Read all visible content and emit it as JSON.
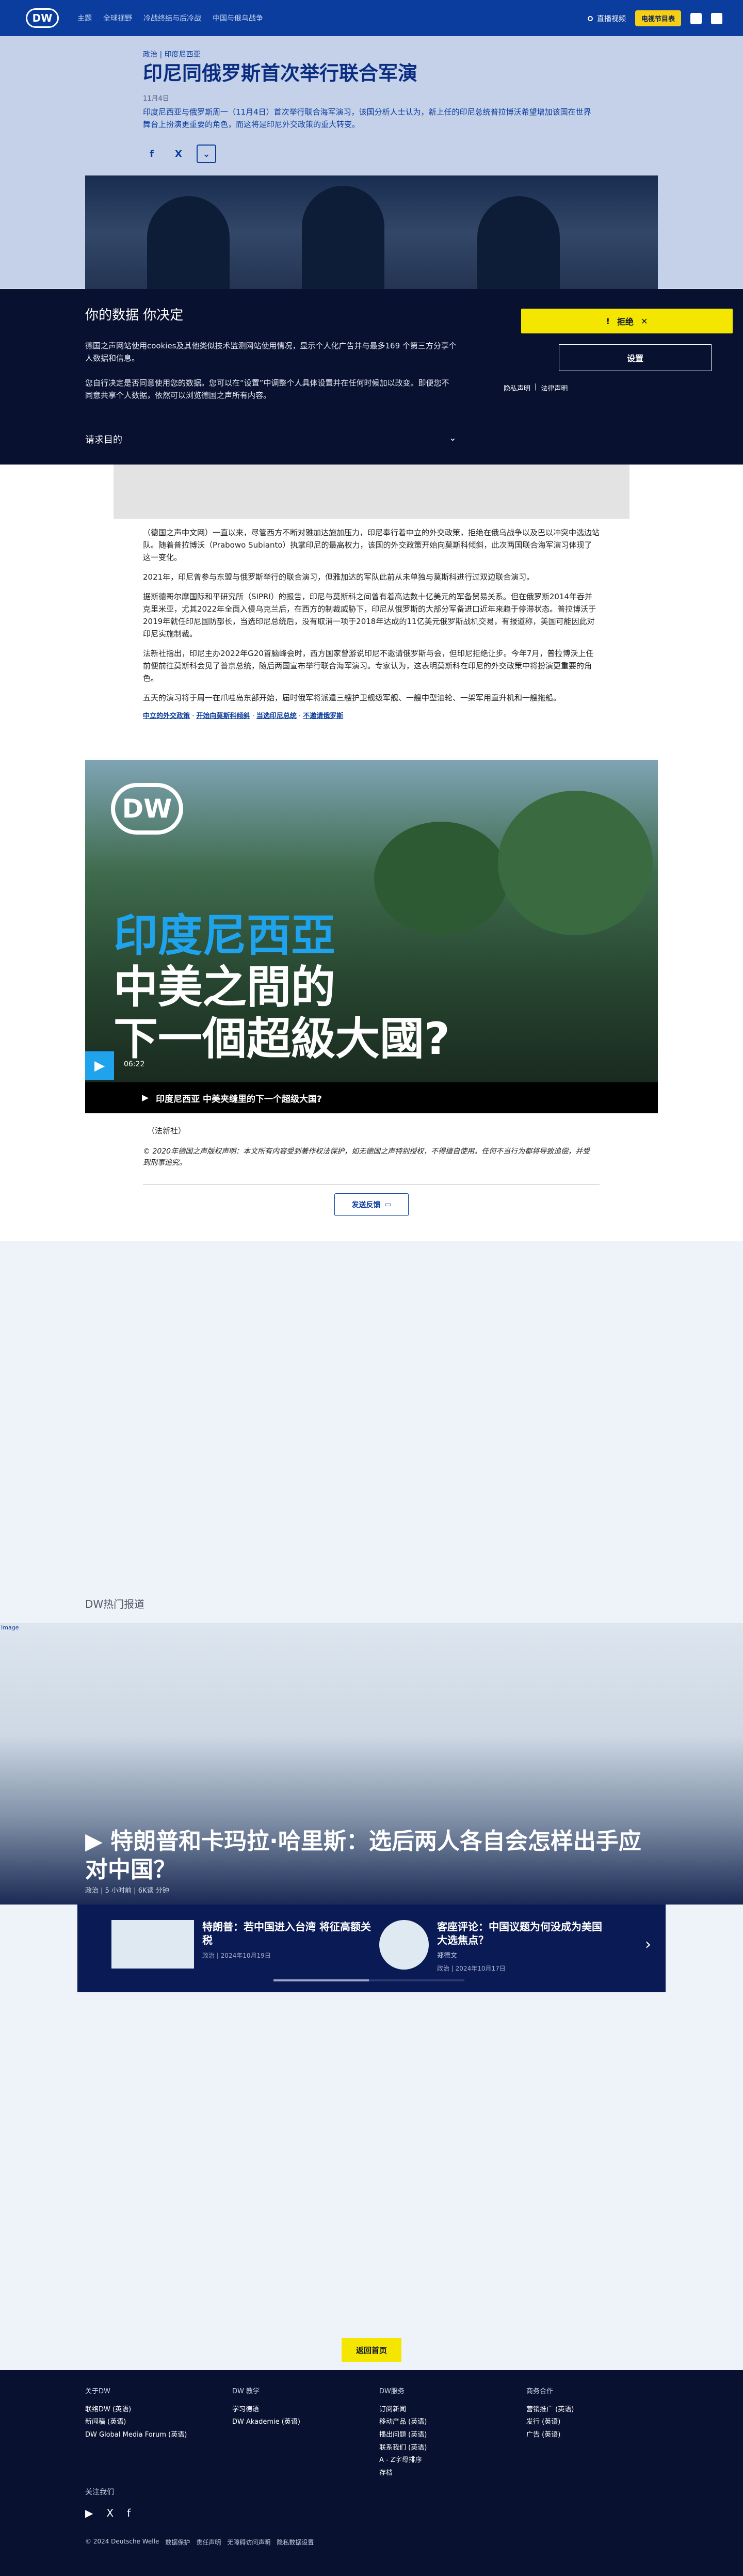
{
  "header": {
    "logo": "DW",
    "nav": [
      "主题",
      "全球视野",
      "冷战终结与后冷战",
      "中国与俄乌战争"
    ],
    "live_label": "直播视频",
    "schedule_label": "电视节目表"
  },
  "article": {
    "kicker": "政治 | 印度尼西亚",
    "title": "印尼同俄罗斯首次举行联合军演",
    "date": "11月4日",
    "lead": "印度尼西亚与俄罗斯周一（11月4日）首次举行联合海军演习，该国分析人士认为，新上任的印尼总统普拉博沃希望增加该国在世界舞台上扮演更重要的角色，而这将是印尼外交政策的重大转变。",
    "share": {
      "facebook": "f",
      "x": "X"
    },
    "paragraphs": [
      {
        "text": "（德国之声中文网）一直以来，尽管西方不断对雅加达施加压力，印尼奉行着中立的外交政策，拒绝在俄乌战争以及巴以冲突中选边站队。随着普拉博沃（Prabowo Subianto）执掌印尼的最高权力，该国的外交政策开始向莫斯科倾斜，此次两国联合海军演习体现了这一变化。"
      },
      {
        "text": "2021年，印尼曾参与东盟与俄罗斯举行的联合演习，但雅加达的军队此前从未单独与莫斯科进行过双边联合演习。"
      },
      {
        "text": "据斯德哥尔摩国际和平研究所（SIPRI）的报告，印尼与莫斯科之间曾有着高达数十亿美元的军备贸易关系。但在俄罗斯2014年吞并克里米亚，尤其2022年全面入侵乌克兰后，在西方的制裁威胁下，印尼从俄罗斯的大部分军备进口近年来趋于停滞状态。普拉博沃于2019年就任印尼国防部长，当选印尼总统后，没有取消一项于2018年达成的11亿美元俄罗斯战机交易，有报道称，美国可能因此对印尼实施制裁。"
      },
      {
        "text": "法新社指出，印尼主办2022年G20首脑峰会时，西方国家曾游说印尼不邀请俄罗斯与会，但印尼拒绝让步。今年7月，普拉博沃上任前便前往莫斯科会见了普京总统，随后两国宣布举行联合海军演习。专家认为，这表明莫斯科在印尼的外交政策中将扮演更重要的角色。"
      },
      {
        "text": "五天的演习将于周一在爪哇岛东部开始，届时俄军将派遣三艘护卫舰级军舰、一艘中型油轮、一架军用直升机和一艘拖船。"
      }
    ],
    "links": [
      "中立的外交政策",
      "开始向莫斯科倾斜",
      "当选印尼总统",
      "不邀请俄罗斯"
    ],
    "video": {
      "logo": "DW",
      "line1": "印度尼西亞",
      "line2": "中美之間的",
      "line3": "下一個超級大國?",
      "duration": "06:22",
      "caption": "印度尼西亚 中美夹缝里的下一个超级大国?"
    },
    "source": "（法新社）",
    "copyright": "© 2020年德国之声版权声明：本文所有内容受到著作权法保护，如无德国之声特别授权，不得擅自使用。任何不当行为都将导致追偿，并受到刑事追究。",
    "feedback_label": "发送反馈"
  },
  "cookie": {
    "title": "你的数据 你决定",
    "p1": "德国之声网站使用cookies及其他类似技术监测网站使用情况，显示个人化广告并与最多169 个第三方分享个人数据和信息。",
    "p2": "您自行决定是否同意使用您的数据。您可以在“设置”中调整个人具体设置并在任何时候加以改变。即便您不同意共享个人数据，依然可以浏览德国之声所有内容。",
    "reject_label": "拒绝",
    "settings_label": "设置",
    "privacy_label": "隐私声明",
    "legal_label": "法律声明",
    "purpose_label": "请求目的"
  },
  "trending": {
    "section_title": "DW热门报道",
    "broken_img_alt": "Image",
    "feature_title": "特朗普和卡玛拉·哈里斯：选后两人各自会怎样出手应对中国？",
    "feature_meta": "政治 | 5 小时前 | 6K读 分钟",
    "cards": [
      {
        "title": "特朗普：若中国进入台湾 将征高额关税",
        "meta": "政治 | 2024年10月19日"
      },
      {
        "title": "客座评论：中国议题为何没成为美国大选焦点？",
        "sub": "郑德文",
        "meta": "政治 | 2024年10月17日"
      }
    ]
  },
  "footer": {
    "top_button": "返回首页",
    "col1": {
      "title": "关于DW",
      "items": [
        "联络DW (英语)",
        "新闻稿 (英语)",
        "DW Global Media Forum (英语)"
      ]
    },
    "col2": {
      "title": "DW 教学",
      "items": [
        "学习德语",
        "DW Akademie (英语)"
      ]
    },
    "col3": {
      "title": "DW服务",
      "items": [
        "订阅新闻",
        "移动产品 (英语)",
        "播出问题 (英语)",
        "联系我们 (英语)",
        "A - Z字母排序",
        "存档"
      ]
    },
    "col4": {
      "title": "商务合作",
      "items": [
        "营销推广 (英语)",
        "发行 (英语)",
        "广告 (英语)"
      ]
    },
    "follow_label": "关注我们",
    "legal": [
      "© 2024 Deutsche Welle",
      "数据保护",
      "责任声明",
      "无障碍访问声明",
      "隐私数据设置"
    ]
  }
}
